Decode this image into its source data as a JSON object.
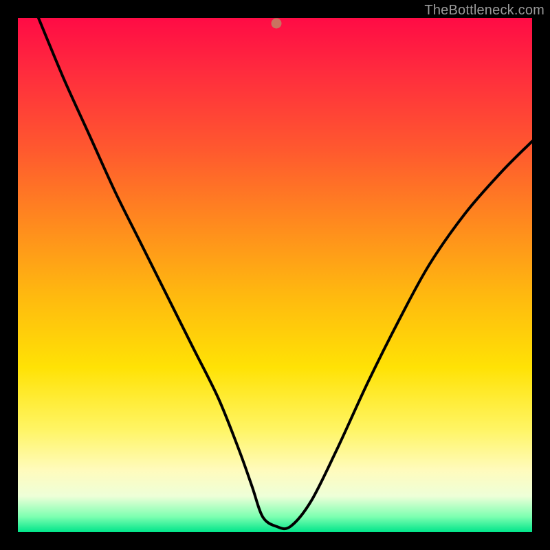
{
  "watermark": "TheBottleneck.com",
  "marker": {
    "x_frac": 0.503,
    "y_frac": 0.989,
    "color": "#c97360"
  },
  "chart_data": {
    "type": "line",
    "title": "",
    "xlabel": "",
    "ylabel": "",
    "xlim": [
      0,
      1
    ],
    "ylim": [
      0,
      1
    ],
    "series": [
      {
        "name": "curve",
        "x": [
          0.04,
          0.09,
          0.14,
          0.19,
          0.24,
          0.29,
          0.34,
          0.39,
          0.43,
          0.455,
          0.476,
          0.503,
          0.53,
          0.57,
          0.62,
          0.68,
          0.74,
          0.8,
          0.87,
          0.94,
          1.0
        ],
        "y": [
          1.0,
          0.88,
          0.77,
          0.66,
          0.56,
          0.46,
          0.36,
          0.26,
          0.16,
          0.09,
          0.03,
          0.011,
          0.011,
          0.06,
          0.16,
          0.29,
          0.41,
          0.52,
          0.62,
          0.7,
          0.76
        ]
      }
    ],
    "background_gradient_stops": [
      {
        "pos": 0.0,
        "color": "#ff0b45"
      },
      {
        "pos": 0.1,
        "color": "#ff2a3e"
      },
      {
        "pos": 0.26,
        "color": "#ff5a2e"
      },
      {
        "pos": 0.4,
        "color": "#ff8a1e"
      },
      {
        "pos": 0.54,
        "color": "#ffb90f"
      },
      {
        "pos": 0.68,
        "color": "#ffe205"
      },
      {
        "pos": 0.8,
        "color": "#fff564"
      },
      {
        "pos": 0.88,
        "color": "#fffbbd"
      },
      {
        "pos": 0.93,
        "color": "#eeffd8"
      },
      {
        "pos": 0.97,
        "color": "#7dffb1"
      },
      {
        "pos": 1.0,
        "color": "#00e58a"
      }
    ]
  }
}
